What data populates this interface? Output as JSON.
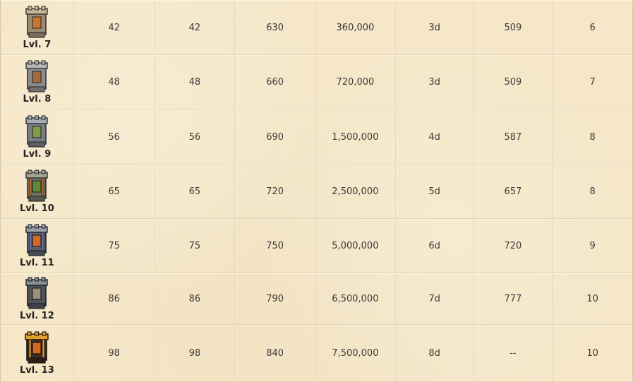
{
  "rows": [
    {
      "level": "Lvl. 7",
      "c1": "42",
      "c2": "42",
      "c3": "630",
      "c4": "360,000",
      "c5": "3d",
      "c6": "509",
      "c7": "6"
    },
    {
      "level": "Lvl. 8",
      "c1": "48",
      "c2": "48",
      "c3": "660",
      "c4": "720,000",
      "c5": "3d",
      "c6": "509",
      "c7": "7"
    },
    {
      "level": "Lvl. 9",
      "c1": "56",
      "c2": "56",
      "c3": "690",
      "c4": "1,500,000",
      "c5": "4d",
      "c6": "587",
      "c7": "8"
    },
    {
      "level": "Lvl. 10",
      "c1": "65",
      "c2": "65",
      "c3": "720",
      "c4": "2,500,000",
      "c5": "5d",
      "c6": "657",
      "c7": "8"
    },
    {
      "level": "Lvl. 11",
      "c1": "75",
      "c2": "75",
      "c3": "750",
      "c4": "5,000,000",
      "c5": "6d",
      "c6": "720",
      "c7": "9"
    },
    {
      "level": "Lvl. 12",
      "c1": "86",
      "c2": "86",
      "c3": "790",
      "c4": "6,500,000",
      "c5": "7d",
      "c6": "777",
      "c7": "10"
    },
    {
      "level": "Lvl. 13",
      "c1": "98",
      "c2": "98",
      "c3": "840",
      "c4": "7,500,000",
      "c5": "8d",
      "c6": "--",
      "c7": "10"
    }
  ],
  "icons": [
    "tower-icon-lvl7",
    "tower-icon-lvl8",
    "tower-icon-lvl9",
    "tower-icon-lvl10",
    "tower-icon-lvl11",
    "tower-icon-lvl12",
    "tower-icon-lvl13"
  ],
  "colors": {
    "background": "#f5e7c8",
    "text": "#3b3b3b",
    "level_text": "#222222",
    "grid": "#e0d2b3"
  }
}
